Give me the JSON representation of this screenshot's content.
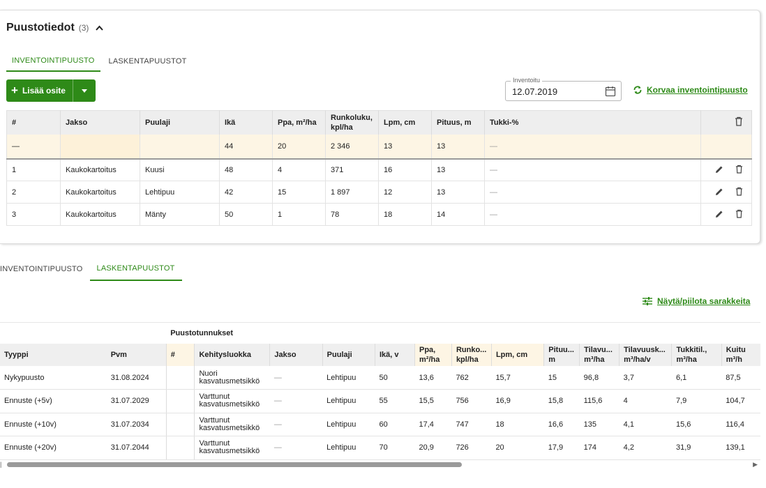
{
  "card": {
    "title": "Puustotiedot",
    "count": "(3)",
    "tabs": [
      "INVENTOINTIPUUSTO",
      "LASKENTAPUUSTOT"
    ],
    "add_button": "Lisää osite",
    "date_label": "Inventoitu",
    "date_value": "12.07.2019",
    "replace_link": "Korvaa inventointipuusto",
    "table": {
      "headers": [
        "#",
        "Jakso",
        "Puulaji",
        "Ikä",
        "Ppa, m²/ha",
        "Runkoluku, kpl/ha",
        "Lpm, cm",
        "Pituus, m",
        "Tukki-%"
      ],
      "summary": [
        "—",
        "",
        "",
        "44",
        "20",
        "2 346",
        "13",
        "13",
        "—"
      ],
      "rows": [
        [
          "1",
          "Kaukokartoitus",
          "Kuusi",
          "48",
          "4",
          "371",
          "16",
          "13",
          "—"
        ],
        [
          "2",
          "Kaukokartoitus",
          "Lehtipuu",
          "42",
          "15",
          "1 897",
          "12",
          "13",
          "—"
        ],
        [
          "3",
          "Kaukokartoitus",
          "Mänty",
          "50",
          "1",
          "78",
          "18",
          "14",
          "—"
        ]
      ]
    }
  },
  "lower": {
    "tabs": [
      "INVENTOINTIPUUSTO",
      "LASKENTAPUUSTOT"
    ],
    "toggle_columns": "Näytä/piilota sarakkeita",
    "group_header": "Puustotunnukset",
    "headers": [
      "Tyyppi",
      "Pvm",
      "#",
      "Kehitysluokka",
      "Jakso",
      "Puulaji",
      "Ikä, v",
      "Ppa, m²/ha",
      "Runko... kpl/ha",
      "Lpm, cm",
      "Pituu... m",
      "Tilavu... m³/ha",
      "Tilavuusk... m³/ha/v",
      "Tukkitil., m³/ha",
      "Kuitu m³/h"
    ],
    "rows": [
      [
        "Nykypuusto",
        "31.08.2024",
        "",
        "Nuori kasvatusmetsikkö",
        "—",
        "Lehtipuu",
        "50",
        "13,6",
        "762",
        "15,7",
        "15",
        "96,8",
        "3,7",
        "6,1",
        "87,5"
      ],
      [
        "Ennuste (+5v)",
        "31.07.2029",
        "",
        "Varttunut kasvatusmetsikkö",
        "—",
        "Lehtipuu",
        "55",
        "15,5",
        "756",
        "16,9",
        "15,8",
        "115,6",
        "4",
        "7,9",
        "104,7"
      ],
      [
        "Ennuste (+10v)",
        "31.07.2034",
        "",
        "Varttunut kasvatusmetsikkö",
        "—",
        "Lehtipuu",
        "60",
        "17,4",
        "747",
        "18",
        "16,6",
        "135",
        "4,1",
        "15,6",
        "116,4"
      ],
      [
        "Ennuste (+20v)",
        "31.07.2044",
        "",
        "Varttunut kasvatusmetsikkö",
        "—",
        "Lehtipuu",
        "70",
        "20,9",
        "726",
        "20",
        "17,9",
        "174",
        "4,2",
        "31,9",
        "139,1"
      ]
    ]
  },
  "colors": {
    "accent": "#2e8a18",
    "summary_bg": "#fdf5e4"
  }
}
